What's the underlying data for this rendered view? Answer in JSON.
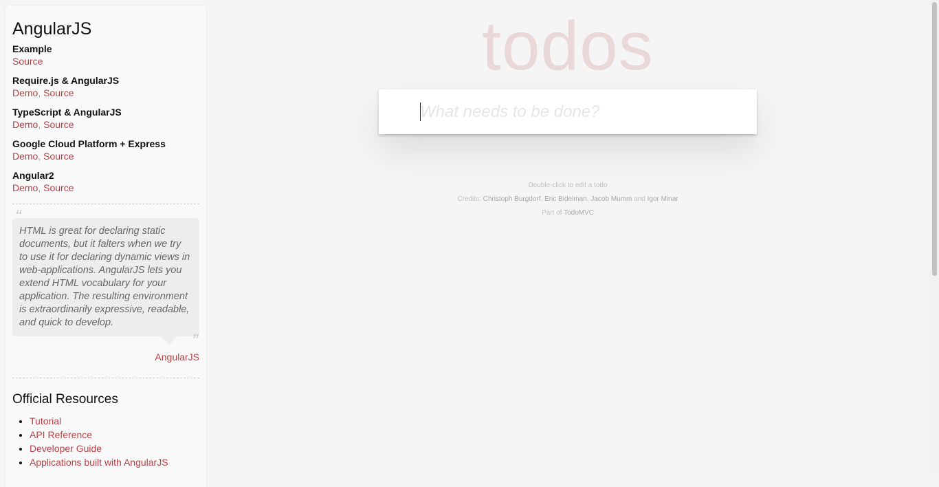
{
  "sidebar": {
    "title": "AngularJS",
    "examples": [
      {
        "name": "Example",
        "links": [
          "Source"
        ]
      },
      {
        "name": "Require.js & AngularJS",
        "links": [
          "Demo",
          "Source"
        ]
      },
      {
        "name": "TypeScript & AngularJS",
        "links": [
          "Demo",
          "Source"
        ]
      },
      {
        "name": "Google Cloud Platform + Express",
        "links": [
          "Demo",
          "Source"
        ]
      },
      {
        "name": "Angular2",
        "links": [
          "Demo",
          "Source"
        ]
      }
    ],
    "link_separator": ",",
    "quote": {
      "open_mark": "“",
      "close_mark": "”",
      "text": "HTML is great for declaring static documents, but it falters when we try to use it for declaring dynamic views in web-applications. AngularJS lets you extend HTML vocabulary for your application. The resulting environment is extraordinarily expressive, readable, and quick to develop.",
      "source": "AngularJS"
    },
    "resources": {
      "title": "Official Resources",
      "items": [
        "Tutorial",
        "API Reference",
        "Developer Guide",
        "Applications built with AngularJS"
      ]
    }
  },
  "app": {
    "title": "todos",
    "new_todo_placeholder": "What needs to be done?",
    "new_todo_value": ""
  },
  "info": {
    "hint": "Double-click to edit a todo",
    "credits_label": "Credits:",
    "credit_names": [
      "Christoph Burgdorf",
      "Eric Bidelman",
      "Jacob Mumm",
      "Igor Minar"
    ],
    "credit_comma": ",",
    "credit_and": "and",
    "part_of_label": "Part of",
    "part_of_link": "TodoMVC"
  },
  "colors": {
    "accent": "#b83f45",
    "title": "#e9d3d3",
    "background": "#f5f5f5"
  }
}
